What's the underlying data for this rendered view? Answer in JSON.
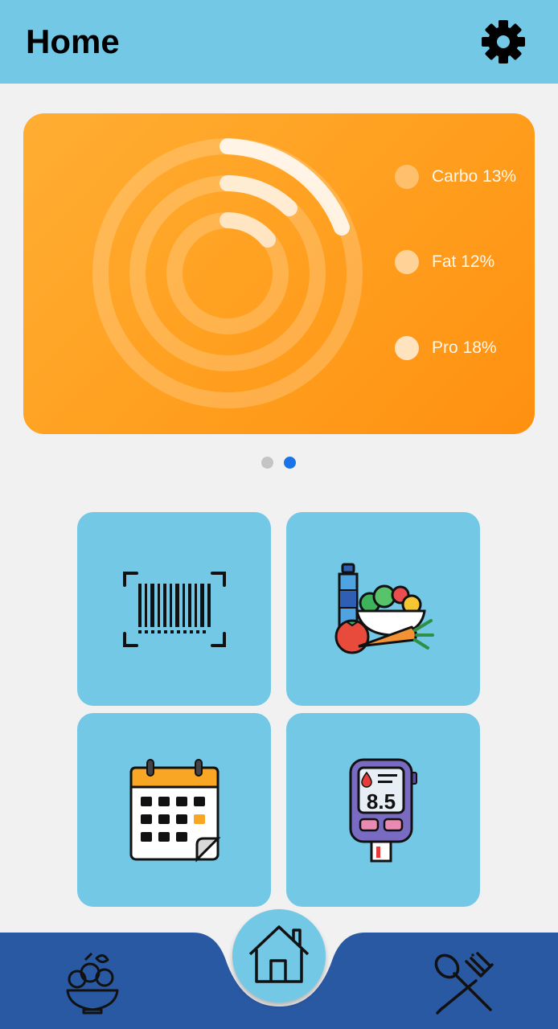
{
  "app_bar": {
    "title": "Home",
    "settings_icon": "gear-icon"
  },
  "macro_card": {
    "legend": [
      {
        "label": "Carbo 13%",
        "value": 13
      },
      {
        "label": "Fat 12%",
        "value": 12
      },
      {
        "label": "Pro 18%",
        "value": 18
      }
    ]
  },
  "pager": {
    "pages": 2,
    "active_index": 1
  },
  "tiles": [
    {
      "icon": "barcode-scanner-icon"
    },
    {
      "icon": "food-groceries-icon"
    },
    {
      "icon": "calendar-icon"
    },
    {
      "icon": "glucose-meter-icon",
      "reading": "8.5"
    }
  ],
  "bottom_nav": {
    "left_icon": "salad-bowl-icon",
    "center_icon": "home-icon",
    "right_icon": "fork-spoon-icon"
  },
  "colors": {
    "app_bar": "#73c8e6",
    "background": "#f1f1f1",
    "card_orange": "#ffa020",
    "tile": "#73c8e6",
    "bottom_nav": "#2a59a3",
    "pager_active": "#1a74e8",
    "pager_inactive": "#c4c4c4"
  }
}
